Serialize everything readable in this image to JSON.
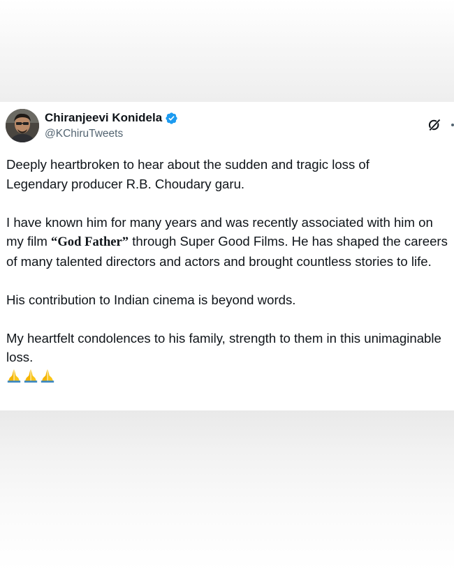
{
  "tweet": {
    "author": {
      "display_name": "Chiranjeevi Konidela",
      "handle": "@KChiruTweets",
      "verified": true
    },
    "colors": {
      "verified_badge": "#1d9bf0",
      "handle": "#536471",
      "text": "#0f1419",
      "emoji": "#f4b400"
    },
    "icons": [
      "verified-badge-icon",
      "grok-icon",
      "more-icon",
      "folded-hands-emoji"
    ],
    "paragraphs": {
      "p1_line1": "Deeply heartbroken to hear about the sudden and tragic loss of",
      "p1_line2": "Legendary producer R.B. Choudary garu.",
      "p2_part1": "I have known him for many years and was recently associated with him on my film ",
      "p2_film": "“God Father”",
      "p2_part2": " through Super Good Films. He has shaped the careers of many talented directors and actors and brought countless stories to life.",
      "p3": "His contribution to Indian cinema is beyond words.",
      "p4": "My heartfelt condolences to his family, strength to them in this unimaginable loss."
    },
    "emoji_count": 3
  }
}
